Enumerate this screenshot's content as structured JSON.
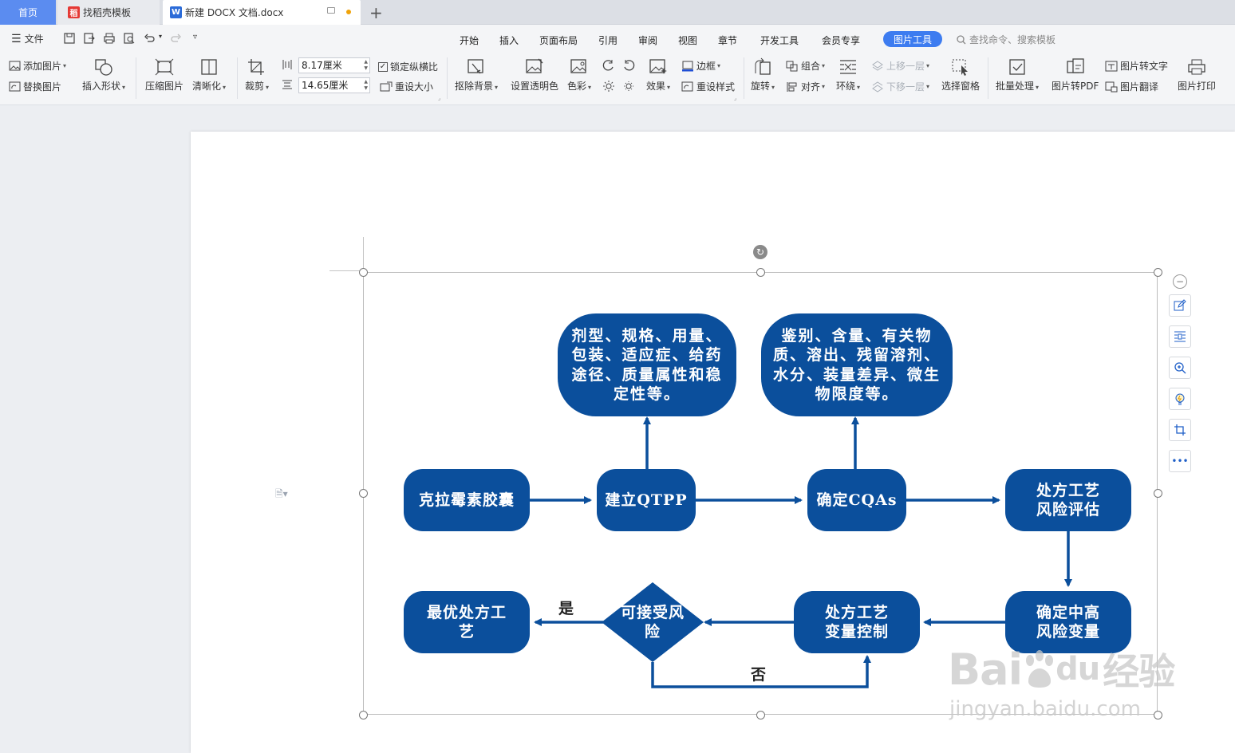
{
  "tabs": {
    "home": "首页",
    "template": "找稻壳模板",
    "document": "新建 DOCX 文档.docx"
  },
  "menu": {
    "file": "文件",
    "items": [
      "开始",
      "插入",
      "页面布局",
      "引用",
      "审阅",
      "视图",
      "章节",
      "开发工具",
      "会员专享"
    ],
    "active": "图片工具",
    "search_placeholder": "查找命令、搜索模板"
  },
  "ribbon": {
    "add_picture": "添加图片",
    "replace_picture": "替换图片",
    "insert_shape": "插入形状",
    "compress_picture": "压缩图片",
    "sharpen": "清晰化",
    "crop": "裁剪",
    "width": "8.17厘米",
    "height": "14.65厘米",
    "lock_ratio": "锁定纵横比",
    "reset_size": "重设大小",
    "remove_background": "抠除背景",
    "set_transparent": "设置透明色",
    "color": "色彩",
    "effects": "效果",
    "border": "边框",
    "reset_style": "重设样式",
    "rotate": "旋转",
    "group": "组合",
    "align": "对齐",
    "wrap": "环绕",
    "bring_forward": "上移一层",
    "send_backward": "下移一层",
    "selection_pane": "选择窗格",
    "batch": "批量处理",
    "to_pdf": "图片转PDF",
    "to_text": "图片转文字",
    "translate": "图片翻译",
    "print": "图片打印"
  },
  "flowchart": {
    "n_start": "克拉霉素胶囊",
    "n_qtpp": "建立QTPP",
    "n_cqas": "确定CQAs",
    "n_risk_eval": "处方工艺风险评估",
    "n_qtpp_detail": "剂型、规格、用量、包装、适应症、给药途径、质量属性和稳定性等。",
    "n_cqas_detail": "鉴别、含量、有关物质、溶出、残留溶剂、水分、装量差异、微生物限度等。",
    "n_high_risk": "确定中高风险变量",
    "n_control": "处方工艺变量控制",
    "n_accept": "可接受风险",
    "n_optimal": "最优处方工艺",
    "label_yes": "是",
    "label_no": "否"
  },
  "watermark": {
    "brand_left": "Bai",
    "brand_mid": "du",
    "brand_right": "经验",
    "url": "jingyan.baidu.com"
  },
  "colors": {
    "node_fill": "#0b4f9c",
    "active_tab": "#3d7cf0",
    "home_tab": "#5b8cf0"
  }
}
